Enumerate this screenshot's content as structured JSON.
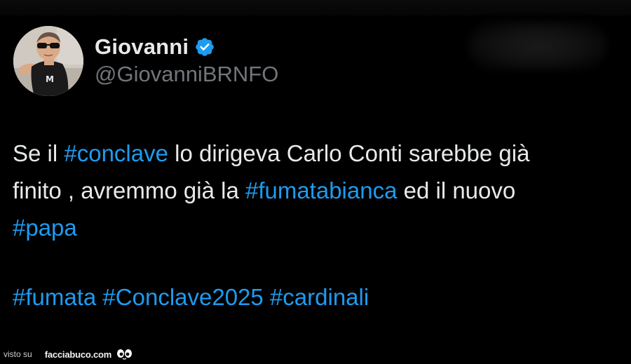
{
  "colors": {
    "background": "#000000",
    "text": "#e7e9ea",
    "handle": "#71767b",
    "hashtag": "#1d9bf0",
    "verified": "#1d9bf0"
  },
  "author": {
    "name": "Giovanni",
    "handle": "@GiovanniBRNFO",
    "verified_icon": "verified-badge-icon",
    "avatar_shirt_text": "M"
  },
  "tweet": {
    "line1": {
      "t1": "Se il ",
      "tag1": "#conclave",
      "t2": " lo dirigeva Carlo Conti sarebbe già"
    },
    "line2": {
      "t1": "finito , avremmo già la ",
      "tag1": "#fumatabianca",
      "t2": " ed il nuovo"
    },
    "line3": {
      "tag1": "#papa"
    },
    "line4": {
      "tag1": "#fumata",
      "tag2": "#Conclave2025",
      "tag3": "#cardinali"
    }
  },
  "watermark": {
    "prefix": "visto su",
    "site": "facciabuco.com"
  }
}
